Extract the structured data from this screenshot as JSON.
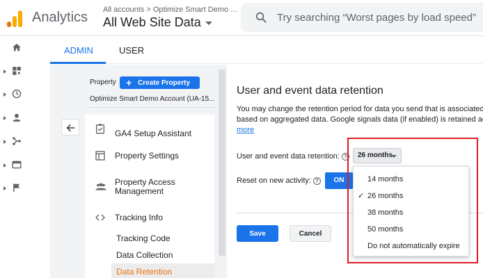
{
  "header": {
    "app_name": "Analytics",
    "breadcrumb": "All accounts > Optimize Smart Demo ...",
    "account_view": "All Web Site Data",
    "search_placeholder": "Try searching “Worst pages by load speed”"
  },
  "rail": {
    "icons": [
      "home-icon",
      "customization-icon",
      "realtime-icon",
      "audience-icon",
      "acquisition-icon",
      "behavior-icon",
      "conversions-icon"
    ]
  },
  "tabs": [
    {
      "label": "ADMIN",
      "active": true
    },
    {
      "label": "USER",
      "active": false
    }
  ],
  "property": {
    "label": "Property",
    "create_button": "Create Property",
    "account_select": "Optimize Smart Demo Account (UA-15..."
  },
  "menu": {
    "items": [
      {
        "label": "GA4 Setup Assistant",
        "icon": "checklist-icon"
      },
      {
        "label": "Property Settings",
        "icon": "layout-icon"
      },
      {
        "label": "Property Access Management",
        "icon": "people-icon"
      },
      {
        "label": "Tracking Info",
        "icon": "code-icon"
      }
    ],
    "subitems": [
      {
        "label": "Tracking Code",
        "active": false
      },
      {
        "label": "Data Collection",
        "active": false
      },
      {
        "label": "Data Retention",
        "active": true
      }
    ]
  },
  "main": {
    "title": "User and event data retention",
    "description_line1": "You may change the retention period for data you send that is associated",
    "description_line2": "based on aggregated data. Google signals data (if enabled) is retained acc",
    "more_link": "more",
    "retention_label": "User and event data retention:",
    "retention_value": "26 months",
    "reset_label": "Reset on new activity:",
    "reset_toggle": "ON",
    "save": "Save",
    "cancel": "Cancel"
  },
  "dropdown": {
    "options": [
      {
        "label": "14 months",
        "selected": false
      },
      {
        "label": "26 months",
        "selected": true
      },
      {
        "label": "38 months",
        "selected": false
      },
      {
        "label": "50 months",
        "selected": false
      },
      {
        "label": "Do not automatically expire",
        "selected": false
      }
    ],
    "check_glyph": "✓"
  },
  "colors": {
    "primary": "#1a73e8",
    "active_nav": "#e8710a",
    "highlight_box": "#e01b24"
  }
}
